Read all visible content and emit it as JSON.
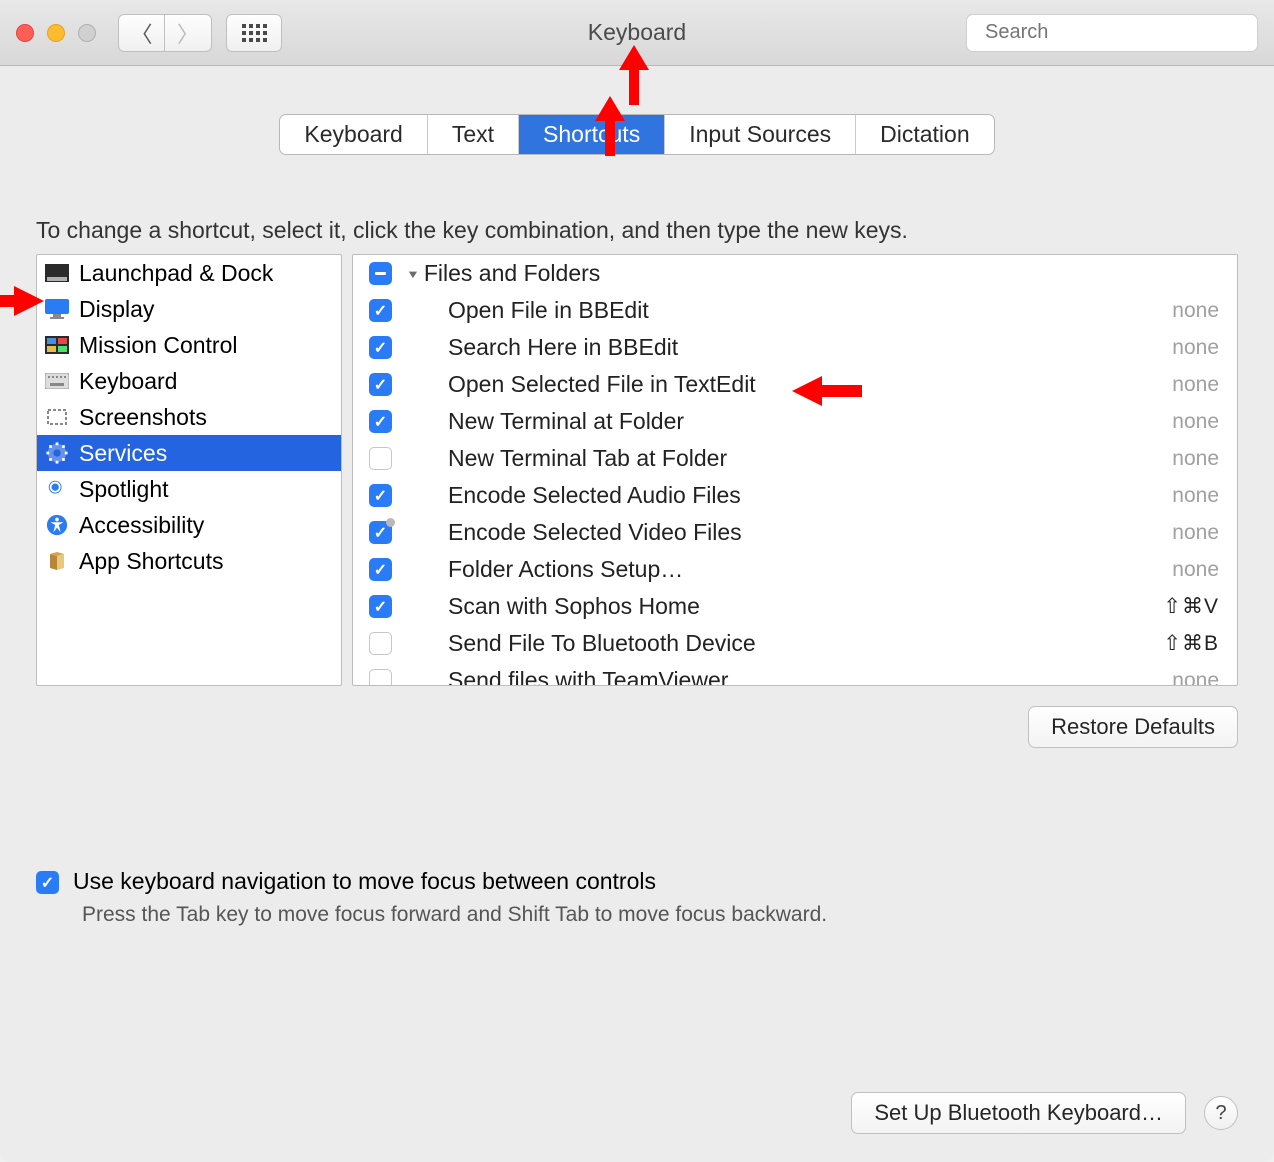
{
  "window": {
    "title": "Keyboard"
  },
  "toolbar": {
    "search_placeholder": "Search"
  },
  "tabs": [
    {
      "label": "Keyboard",
      "active": false
    },
    {
      "label": "Text",
      "active": false
    },
    {
      "label": "Shortcuts",
      "active": true
    },
    {
      "label": "Input Sources",
      "active": false
    },
    {
      "label": "Dictation",
      "active": false
    }
  ],
  "instruction": "To change a shortcut, select it, click the key combination, and then type the new keys.",
  "categories": [
    {
      "label": "Launchpad & Dock",
      "icon": "launchpad",
      "selected": false
    },
    {
      "label": "Display",
      "icon": "display",
      "selected": false
    },
    {
      "label": "Mission Control",
      "icon": "mission",
      "selected": false
    },
    {
      "label": "Keyboard",
      "icon": "keyboard",
      "selected": false
    },
    {
      "label": "Screenshots",
      "icon": "screenshot",
      "selected": false
    },
    {
      "label": "Services",
      "icon": "gear",
      "selected": true
    },
    {
      "label": "Spotlight",
      "icon": "spotlight",
      "selected": false
    },
    {
      "label": "Accessibility",
      "icon": "accessibility",
      "selected": false
    },
    {
      "label": "App Shortcuts",
      "icon": "app",
      "selected": false
    }
  ],
  "services": {
    "group_label": "Files and Folders",
    "group_state": "mixed",
    "items": [
      {
        "label": "Open File in BBEdit",
        "checked": true,
        "shortcut": "none",
        "shortcut_style": "none"
      },
      {
        "label": "Search Here in BBEdit",
        "checked": true,
        "shortcut": "none",
        "shortcut_style": "none"
      },
      {
        "label": "Open Selected File in TextEdit",
        "checked": true,
        "shortcut": "none",
        "shortcut_style": "none"
      },
      {
        "label": "New Terminal at Folder",
        "checked": true,
        "shortcut": "none",
        "shortcut_style": "none"
      },
      {
        "label": "New Terminal Tab at Folder",
        "checked": false,
        "shortcut": "none",
        "shortcut_style": "none"
      },
      {
        "label": "Encode Selected Audio Files",
        "checked": true,
        "shortcut": "none",
        "shortcut_style": "none"
      },
      {
        "label": "Encode Selected Video Files",
        "checked": true,
        "shortcut": "none",
        "shortcut_style": "none"
      },
      {
        "label": "Folder Actions Setup…",
        "checked": true,
        "shortcut": "none",
        "shortcut_style": "none"
      },
      {
        "label": "Scan with Sophos Home",
        "checked": true,
        "shortcut": "⇧⌘V",
        "shortcut_style": "key"
      },
      {
        "label": "Send File To Bluetooth Device",
        "checked": false,
        "shortcut": "⇧⌘B",
        "shortcut_style": "key"
      },
      {
        "label": "Send files with TeamViewer",
        "checked": false,
        "shortcut": "none",
        "shortcut_style": "none"
      }
    ]
  },
  "restore_label": "Restore Defaults",
  "kbnav": {
    "checked": true,
    "label": "Use keyboard navigation to move focus between controls",
    "sub": "Press the Tab key to move focus forward and Shift Tab to move focus backward."
  },
  "bottom": {
    "bluetooth_label": "Set Up Bluetooth Keyboard…",
    "help": "?"
  },
  "arrow_color": "#ff0000"
}
